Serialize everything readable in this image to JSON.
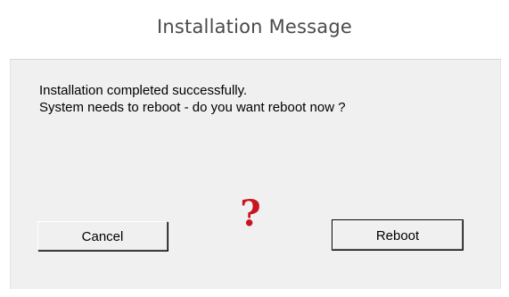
{
  "window": {
    "title": "Installation Message"
  },
  "message": {
    "line1": "Installation completed successfully.",
    "line2": "System needs to reboot - do you want reboot now ?"
  },
  "icon": {
    "name": "question-icon",
    "glyph": "?",
    "color": "#c8141e"
  },
  "buttons": {
    "cancel_label": "Cancel",
    "reboot_label": "Reboot"
  }
}
